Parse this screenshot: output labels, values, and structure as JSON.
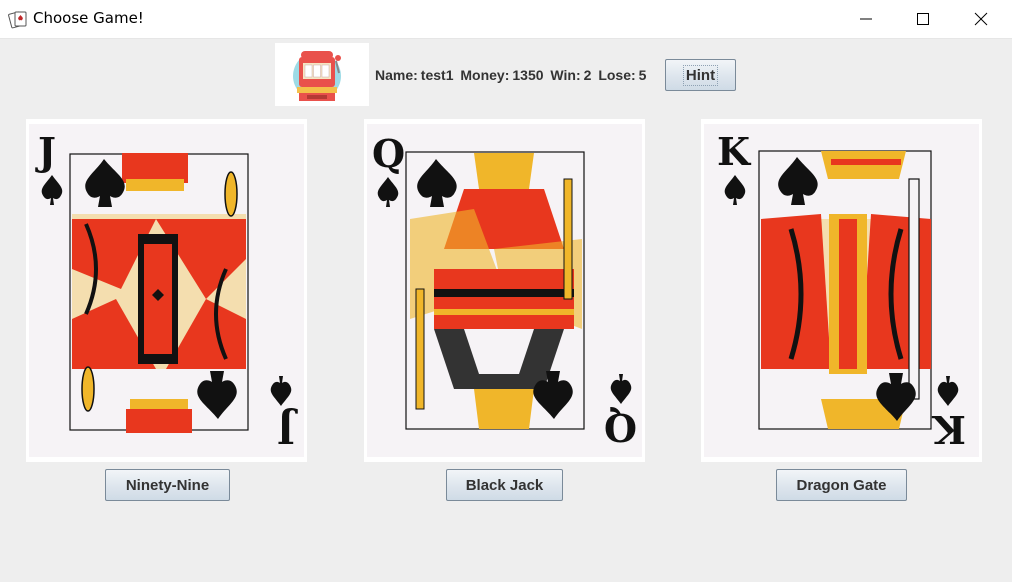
{
  "window": {
    "title": "Choose Game!",
    "icon": "cards-app-icon"
  },
  "player": {
    "name_label": "Name:",
    "name": "test1",
    "money_label": "Money:",
    "money": "1350",
    "win_label": "Win:",
    "win": "2",
    "lose_label": "Lose:",
    "lose": "5"
  },
  "hint_button": {
    "label": "Hint"
  },
  "cards": [
    {
      "rank": "J",
      "suit": "spade",
      "icon": "jack-of-spades-card"
    },
    {
      "rank": "Q",
      "suit": "spade",
      "icon": "queen-of-spades-card"
    },
    {
      "rank": "K",
      "suit": "spade",
      "icon": "king-of-spades-card"
    }
  ],
  "games": [
    {
      "label": "Ninety-Nine"
    },
    {
      "label": "Black Jack"
    },
    {
      "label": "Dragon Gate"
    }
  ],
  "colors": {
    "card_red": "#e8371e",
    "card_gold": "#f0b62a",
    "card_black": "#111111",
    "background": "#eeeeee"
  }
}
